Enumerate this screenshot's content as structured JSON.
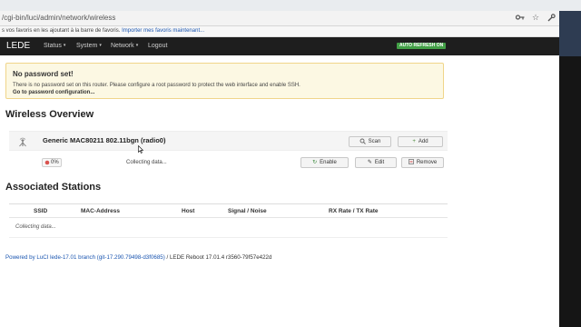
{
  "browser": {
    "url": "/cgi-bin/luci/admin/network/wireless",
    "bookmarks_message": "s vos favoris en les ajoutant à la barre de favoris.",
    "bookmarks_link": "Importer mes favoris maintenant...",
    "icons": [
      "key-icon",
      "star-icon",
      "wrench-icon"
    ]
  },
  "header": {
    "brand": "LEDE",
    "nav": [
      {
        "label": "Status",
        "has_caret": true
      },
      {
        "label": "System",
        "has_caret": true
      },
      {
        "label": "Network",
        "has_caret": true
      },
      {
        "label": "Logout",
        "has_caret": false
      }
    ],
    "caret": "▾",
    "autorefresh": "AUTO REFRESH ON"
  },
  "alert": {
    "title": "No password set!",
    "description": "There is no password set on this router. Please configure a root password to protect the web interface and enable SSH.",
    "link": "Go to password configuration..."
  },
  "wireless": {
    "heading": "Wireless Overview",
    "device_name": "Generic MAC80211 802.11bgn (radio0)",
    "scan_label": "Scan",
    "add_label": "Add",
    "signal_value": "0%",
    "collecting": "Collecting data...",
    "enable_label": "Enable",
    "edit_label": "Edit",
    "remove_label": "Remove"
  },
  "stations": {
    "heading": "Associated Stations",
    "columns": [
      "SSID",
      "MAC-Address",
      "Host",
      "Signal / Noise",
      "RX Rate / TX Rate"
    ],
    "empty_text": "Collecting data..."
  },
  "footer": {
    "link_text": "Powered by LuCI lede-17.01 branch (git-17.290.79498-d3f0685)",
    "rest": " / LEDE Reboot 17.01.4 r3560-79f57e422d"
  },
  "colors": {
    "header_bg": "#1e1e1e",
    "alert_bg": "#fcf8e3",
    "alert_border": "#f0d58a",
    "autorefresh_bg": "#43a047",
    "link": "#1a55b0"
  }
}
